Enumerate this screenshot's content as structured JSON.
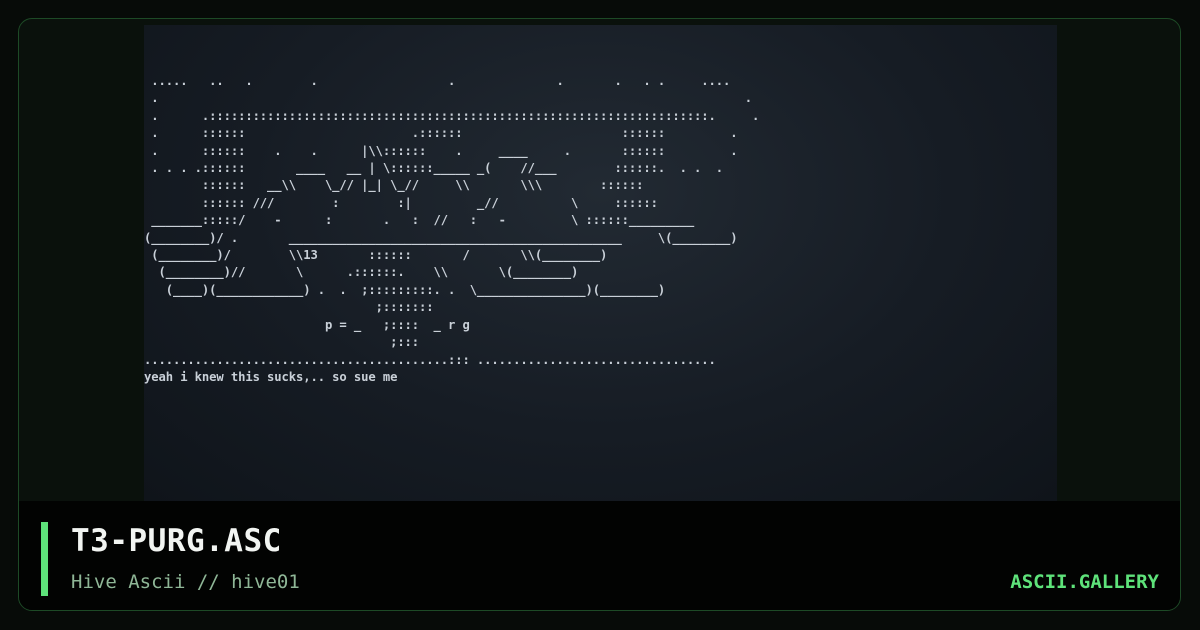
{
  "card": {
    "title": "T3-PURG.ASC",
    "subtitle": "Hive Ascii // hive01",
    "brand": "ASCII.GALLERY"
  },
  "artwork": {
    "ascii": " .....   ..   .        .                  .              .       .   . .     .... \n .                                                                                 . \n .      .:::::::::::::::::::::::::::::::::::::::::::::::::::::::::::::::::::::.     . \n .      ::::::                       .::::::                      ::::::         . \n .      ::::::    .    .      |\\\\::::::    .     ____     .       ::::::         . \n . . . .::::::       ____   __ | \\::::::_____ _(    //___        ::::::.  . .  . \n        ::::::   __\\\\    \\_// |_| \\_//     \\\\       \\\\\\        :::::: \n        :::::: ///        :        :|         _//          \\     ::::::  \n _______:::::/    -      :       .   :  //   :   -         \\ ::::::_________ \n(________)/ .       ______________________________________________     \\(________) \n (________)/        \\\\13       ::::::       /       \\\\(________) \n  (________)//       \\      .::::::.    \\\\       \\(________) \n   (____)(____________) .  .  ;:::::::::. .  \\_______________)(________) \n                                ;::::::: \n                         p = _   ;::::  _ r g \n                                  ;::: \n..........................................::: ................................. \nyeah i knew this sucks,.. so sue me"
  }
}
